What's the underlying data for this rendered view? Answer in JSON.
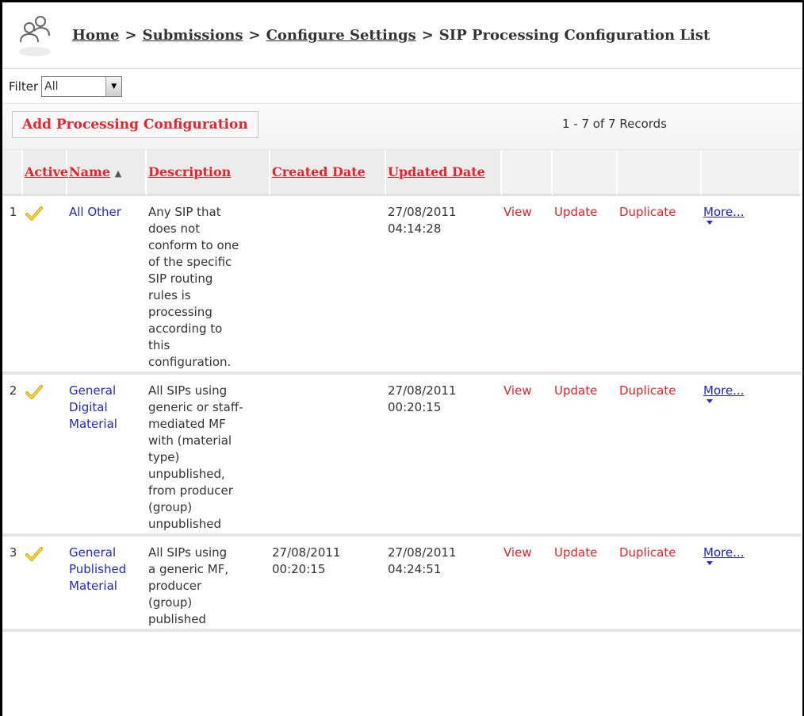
{
  "breadcrumb": {
    "home": "Home",
    "submissions": "Submissions",
    "configure_settings": "Configure Settings",
    "separator": ">",
    "current": "SIP Processing Configuration List"
  },
  "filter": {
    "label": "Filter",
    "selected": "All"
  },
  "actions": {
    "add_label": "Add Processing Configuration",
    "records": "1 - 7 of 7 Records"
  },
  "table": {
    "columns": {
      "active": "Active",
      "name": "Name",
      "sort_indicator": "▲",
      "description": "Description",
      "created": "Created Date",
      "updated": "Updated Date"
    },
    "rows": [
      {
        "num": "1",
        "name": [
          "All Other"
        ],
        "description": [
          "Any SIP that",
          "does not",
          "conform to one",
          "of the specific",
          "SIP routing",
          "rules is",
          "processing",
          "according to",
          "this",
          "configuration."
        ],
        "created": [
          "",
          ""
        ],
        "updated": [
          "27/08/2011",
          "04:14:28"
        ],
        "view": "View",
        "update": "Update",
        "duplicate": "Duplicate",
        "more": "More..."
      },
      {
        "num": "2",
        "name": [
          "General",
          "Digital",
          "Material"
        ],
        "description": [
          "All SIPs using",
          "generic or staff-",
          "mediated MF",
          "with (material",
          "type)",
          "unpublished,",
          "from producer",
          "(group)",
          "unpublished"
        ],
        "created": [
          "",
          ""
        ],
        "updated": [
          "27/08/2011",
          "00:20:15"
        ],
        "view": "View",
        "update": "Update",
        "duplicate": "Duplicate",
        "more": "More..."
      },
      {
        "num": "3",
        "name": [
          "General",
          "Published",
          "Material"
        ],
        "description": [
          "All SIPs using",
          "a generic MF,",
          "producer",
          "(group)",
          "published"
        ],
        "created": [
          "27/08/2011",
          "00:20:15"
        ],
        "updated": [
          "27/08/2011",
          "04:24:51"
        ],
        "view": "View",
        "update": "Update",
        "duplicate": "Duplicate",
        "more": "More..."
      }
    ]
  },
  "colors": {
    "accent_red": "#e8232a",
    "link_blue": "#2227c8",
    "check_yellow": "#f0c020"
  },
  "icons": {
    "header": "users-icon",
    "active": "checkmark-icon",
    "dropdown": "chevron-down-icon"
  }
}
